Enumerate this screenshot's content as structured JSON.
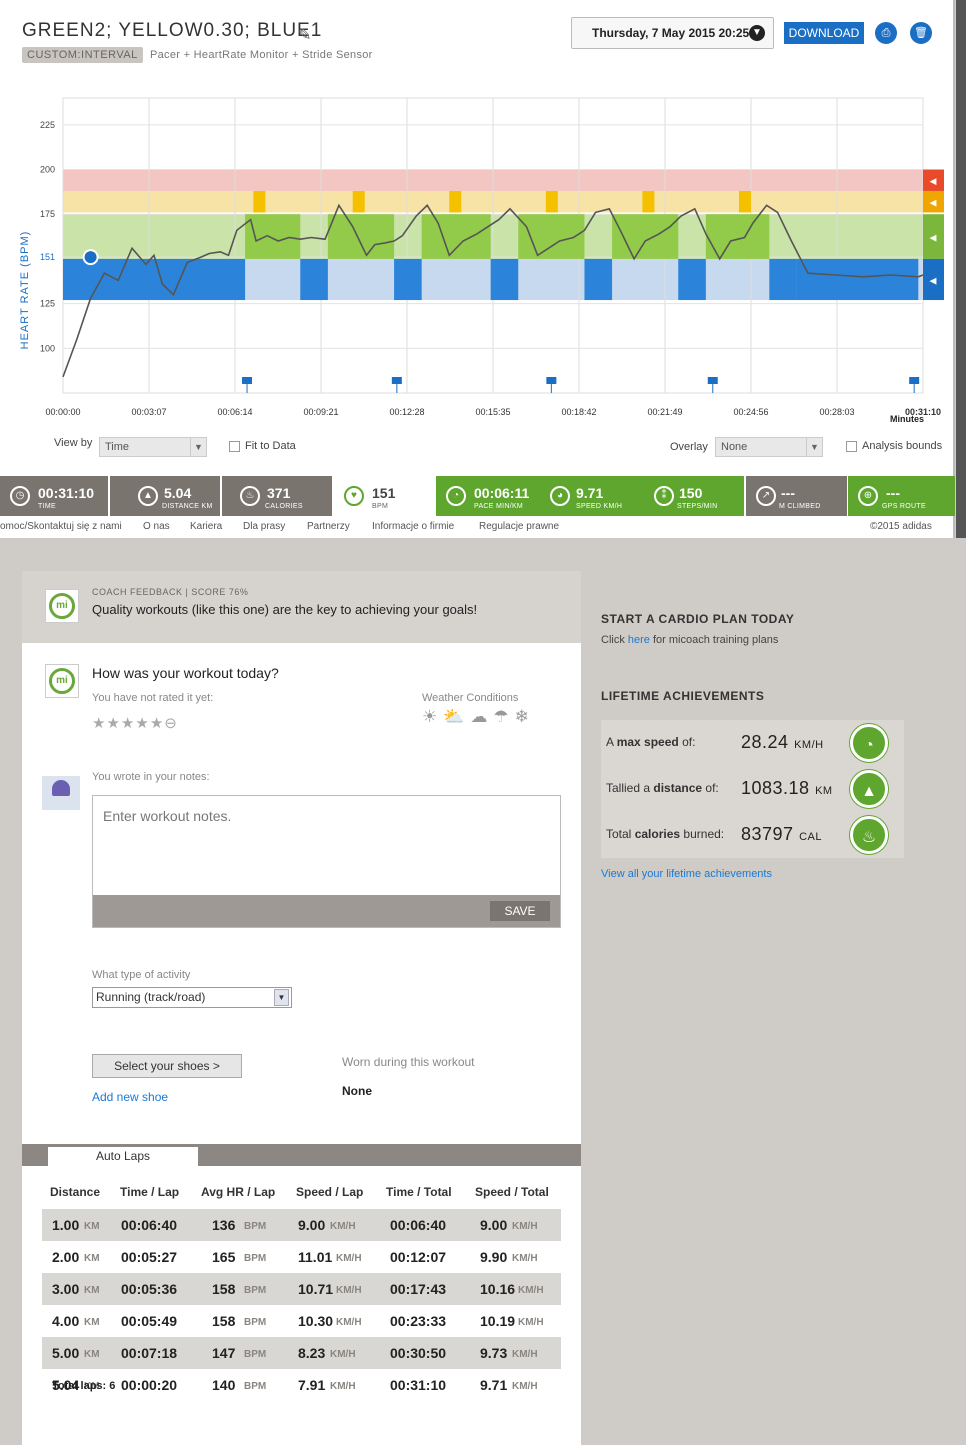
{
  "header": {
    "title": "GREEN2; YELLOW0.30; BLUE1",
    "badge": "CUSTOM:INTERVAL",
    "devices": "Pacer + HeartRate Monitor + Stride Sensor",
    "date": "Thursday, 7 May 2015 20:25",
    "download": "DOWNLOAD"
  },
  "chart_data": {
    "type": "line",
    "ylabel": "HEART RATE (BPM)",
    "xlabel": "Minutes",
    "yticks": [
      100,
      125,
      151,
      175,
      200,
      225
    ],
    "ylim": [
      75,
      240
    ],
    "xticks": [
      "00:00:00",
      "00:03:07",
      "00:06:14",
      "00:09:21",
      "00:12:28",
      "00:15:35",
      "00:18:42",
      "00:21:49",
      "00:24:56",
      "00:28:03",
      "00:31:10"
    ],
    "zones": [
      {
        "name": "red",
        "from": 188,
        "to": 200,
        "color": "#f3c6c3"
      },
      {
        "name": "yellow",
        "from": 176,
        "to": 188,
        "color": "#f7e3a6"
      },
      {
        "name": "green",
        "from": 150,
        "to": 175,
        "color": "#c9e3a8"
      },
      {
        "name": "blue",
        "from": 127,
        "to": 150,
        "color": "#c7d9ee"
      }
    ],
    "target_hr": 151,
    "x_minutes": [
      0,
      0.5,
      1,
      1.5,
      2,
      2.5,
      3,
      3.3,
      3.6,
      4,
      4.5,
      5,
      5.3,
      5.7,
      6,
      6.3,
      6.8,
      7,
      7.4,
      7.8,
      8.2,
      8.6,
      9,
      9.5,
      10,
      10.5,
      11,
      11.3,
      11.7,
      12,
      12.3,
      12.8,
      13.2,
      13.6,
      14,
      14.5,
      15,
      15.4,
      15.8,
      16.2,
      16.8,
      17.2,
      17.6,
      18,
      18.5,
      18.9,
      19.3,
      19.8,
      20.2,
      20.7,
      21.1,
      21.6,
      22,
      22.4,
      22.9,
      23.3,
      23.8,
      24.2,
      24.7,
      25,
      25.5,
      25.9,
      26.4,
      27,
      28,
      29,
      30,
      31,
      31.17
    ],
    "y_bpm": [
      84,
      105,
      128,
      142,
      138,
      156,
      147,
      152,
      136,
      130,
      148,
      151,
      153,
      154,
      152,
      166,
      172,
      160,
      163,
      160,
      162,
      161,
      162,
      161,
      180,
      168,
      152,
      158,
      159,
      160,
      163,
      174,
      180,
      170,
      152,
      160,
      164,
      168,
      172,
      178,
      168,
      152,
      156,
      160,
      162,
      166,
      176,
      178,
      166,
      150,
      160,
      164,
      168,
      174,
      178,
      164,
      150,
      160,
      162,
      170,
      180,
      176,
      160,
      142,
      141,
      140,
      141,
      140,
      141
    ]
  },
  "controls": {
    "viewby_label": "View by",
    "viewby_value": "Time",
    "fit_to_data": "Fit to Data",
    "overlay_label": "Overlay",
    "overlay_value": "None",
    "analysis_bounds": "Analysis bounds"
  },
  "stats": [
    {
      "value": "00:31:10",
      "label": "TIME",
      "color": "#7a746e"
    },
    {
      "value": "5.04",
      "label": "DISTANCE KM",
      "color": "#7a746e"
    },
    {
      "value": "371",
      "label": "CALORIES",
      "color": "#7a746e"
    },
    {
      "value": "151",
      "label": "BPM",
      "color": "#ffffff"
    },
    {
      "value": "00:06:11",
      "label": "PACE MIN/KM",
      "color": "#5fa62e"
    },
    {
      "value": "9.71",
      "label": "SPEED KM/H",
      "color": "#5fa62e"
    },
    {
      "value": "150",
      "label": "STEPS/MIN",
      "color": "#5fa62e"
    },
    {
      "value": "---",
      "label": "M CLIMBED",
      "color": "#7a746e"
    },
    {
      "value": "---",
      "label": "GPS ROUTE",
      "color": "#5fa62e"
    }
  ],
  "footer": {
    "links": [
      "omoc/Skontaktuj się z nami",
      "O nas",
      "Kariera",
      "Dla prasy",
      "Partnerzy",
      "Informacje o firmie",
      "Regulacje prawne"
    ],
    "copyright": "©2015 adidas"
  },
  "coach": {
    "logo": "mi",
    "meta": "COACH FEEDBACK | SCORE 76%",
    "message": "Quality workouts (like this one) are the key to achieving your goals!"
  },
  "rating": {
    "question": "How was your workout today?",
    "not_rated": "You have not rated it yet:",
    "weather_label": "Weather Conditions"
  },
  "notes": {
    "label": "You wrote in your notes:",
    "placeholder": "Enter workout notes.",
    "save": "SAVE"
  },
  "activity": {
    "label": "What type of activity",
    "value": "Running (track/road)"
  },
  "shoes": {
    "select": "Select your shoes >",
    "add": "Add new shoe",
    "worn_label": "Worn during this workout",
    "worn_value": "None"
  },
  "laps": {
    "tab": "Auto Laps",
    "headers": [
      "Distance",
      "Time / Lap",
      "Avg HR / Lap",
      "Speed / Lap",
      "Time / Total",
      "Speed / Total"
    ],
    "rows": [
      [
        "1.00",
        "00:06:40",
        "136",
        "9.00",
        "00:06:40",
        "9.00"
      ],
      [
        "2.00",
        "00:05:27",
        "165",
        "11.01",
        "00:12:07",
        "9.90"
      ],
      [
        "3.00",
        "00:05:36",
        "158",
        "10.71",
        "00:17:43",
        "10.16"
      ],
      [
        "4.00",
        "00:05:49",
        "158",
        "10.30",
        "00:23:33",
        "10.19"
      ],
      [
        "5.00",
        "00:07:18",
        "147",
        "8.23",
        "00:30:50",
        "9.73"
      ],
      [
        "5.04",
        "00:00:20",
        "140",
        "7.91",
        "00:31:10",
        "9.71"
      ]
    ],
    "units": {
      "km": "KM",
      "bpm": "BPM",
      "kmh": "KM/H"
    },
    "total": "Total laps: 6"
  },
  "side": {
    "cardio_title": "START A CARDIO PLAN TODAY",
    "cardio_pre": "Click",
    "cardio_link": "here",
    "cardio_post": "for micoach training plans",
    "lifetime_title": "LIFETIME ACHIEVEMENTS",
    "achievements": [
      {
        "prefix": "A",
        "bold": "max speed",
        "suffix": "of:",
        "value": "28.24",
        "unit": "KM/H"
      },
      {
        "prefix": "Tallied a",
        "bold": "distance",
        "suffix": "of:",
        "value": "1083.18",
        "unit": "KM"
      },
      {
        "prefix": "Total",
        "bold": "calories",
        "suffix": "burned:",
        "value": "83797",
        "unit": "CAL"
      }
    ],
    "view_all": "View all your lifetime achievements"
  }
}
